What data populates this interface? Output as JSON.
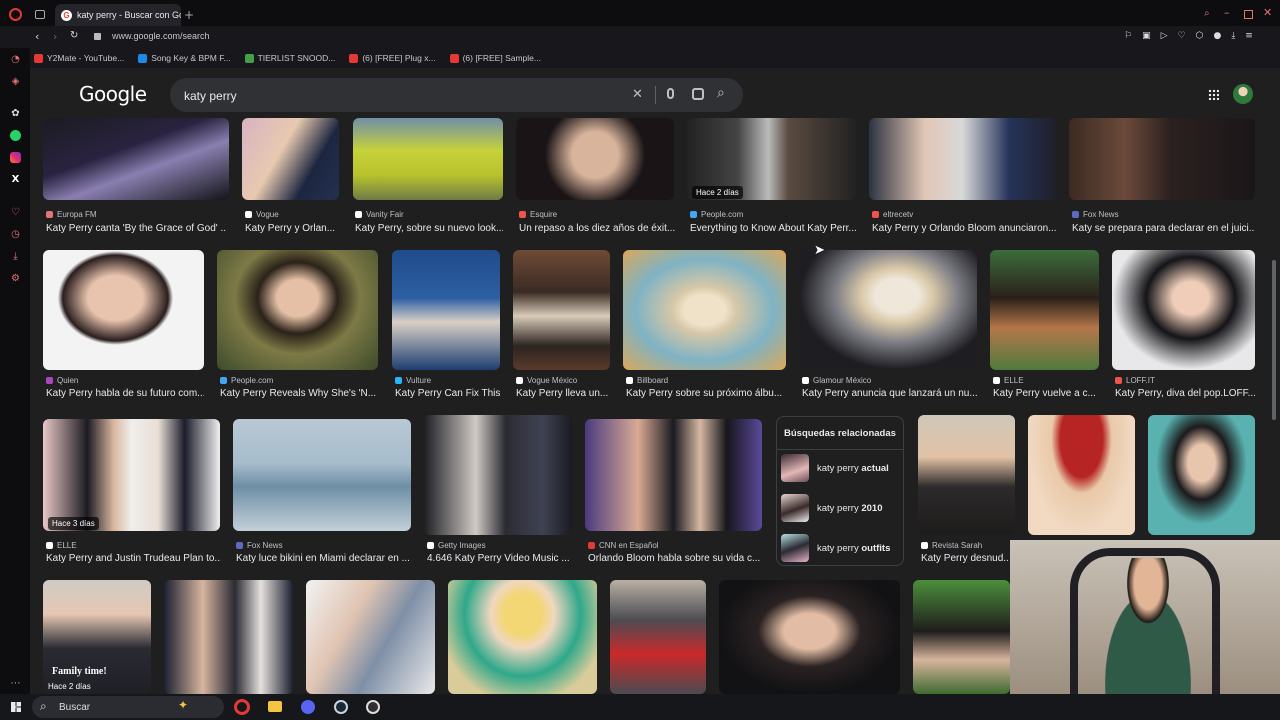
{
  "browser": {
    "tab_title": "katy perry - Buscar con Go",
    "url": "www.google.com/search",
    "bookmarks": [
      {
        "label": "Y2Mate - YouTube...",
        "color": "#e53935"
      },
      {
        "label": "Song Key & BPM F...",
        "color": "#1e88e5"
      },
      {
        "label": "TIERLIST SNOOD...",
        "color": "#43a047"
      },
      {
        "label": "(6) [FREE] Plug x...",
        "color": "#e53935"
      },
      {
        "label": "(6) [FREE] Sample...",
        "color": "#e53935"
      }
    ]
  },
  "google": {
    "logo": "Google",
    "query": "katy perry"
  },
  "row1": [
    {
      "source": "Europa FM",
      "caption": "Katy Perry canta 'By the Grace of God' ...",
      "badge": "",
      "src_color": "#e57373"
    },
    {
      "source": "Vogue",
      "caption": "Katy Perry y Orlan...",
      "badge": "",
      "src_color": "#ffffff"
    },
    {
      "source": "Vanity Fair",
      "caption": "Katy Perry, sobre su nuevo look...",
      "badge": "",
      "src_color": "#ffffff"
    },
    {
      "source": "Esquire",
      "caption": "Un repaso a los diez años de éxit...",
      "badge": "",
      "src_color": "#ef5350"
    },
    {
      "source": "People.com",
      "caption": "Everything to Know About Katy Perr...",
      "badge": "Hace 2 días",
      "src_color": "#42a5f5"
    },
    {
      "source": "eltrecetv",
      "caption": "Katy Perry y Orlando Bloom anunciaron...",
      "badge": "",
      "src_color": "#ef5350"
    },
    {
      "source": "Fox News",
      "caption": "Katy se prepara para declarar en el juici...",
      "badge": "",
      "src_color": "#5c6bc0"
    }
  ],
  "row2": [
    {
      "source": "Quien",
      "caption": "Katy Perry habla de su futuro com...",
      "src_color": "#ab47bc"
    },
    {
      "source": "People.com",
      "caption": "Katy Perry Reveals Why She's 'N...",
      "src_color": "#42a5f5"
    },
    {
      "source": "Vulture",
      "caption": "Katy Perry Can Fix This",
      "src_color": "#29b6f6"
    },
    {
      "source": "Vogue México",
      "caption": "Katy Perry lleva un...",
      "src_color": "#ffffff"
    },
    {
      "source": "Billboard",
      "caption": "Katy Perry sobre su próximo álbu...",
      "src_color": "#ffffff"
    },
    {
      "source": "Glamour México",
      "caption": "Katy Perry anuncia que lanzará un nu...",
      "src_color": "#ffffff"
    },
    {
      "source": "ELLE",
      "caption": "Katy Perry vuelve a c...",
      "src_color": "#ffffff"
    },
    {
      "source": "LOFF.IT",
      "caption": "Katy Perry, diva del pop.LOFF...",
      "src_color": "#ef5350"
    }
  ],
  "row3": [
    {
      "source": "ELLE",
      "caption": "Katy Perry and Justin Trudeau Plan to...",
      "badge": "Hace 3 días",
      "src_color": "#ffffff"
    },
    {
      "source": "Fox News",
      "caption": "Katy luce bikini en Miami declarar en ...",
      "badge": "",
      "src_color": "#5c6bc0"
    },
    {
      "source": "Getty Images",
      "caption": "4.646 Katy Perry Video Music ...",
      "badge": "",
      "src_color": "#ffffff"
    },
    {
      "source": "CNN en Español",
      "caption": "Orlando Bloom habla sobre su vida c...",
      "badge": "",
      "src_color": "#e53935"
    },
    {
      "source": "Revista Sarah",
      "caption": "Katy Perry desnud...",
      "badge": "",
      "src_color": "#ffffff"
    }
  ],
  "related": {
    "title": "Búsquedas relacionadas",
    "items": [
      {
        "prefix": "katy perry",
        "bold": "actual"
      },
      {
        "prefix": "katy perry",
        "bold": "2010"
      },
      {
        "prefix": "katy perry",
        "bold": "outfits"
      }
    ]
  },
  "row4": [
    {
      "badge": "Hace 2 días",
      "overlay": "Family time!"
    }
  ],
  "taskbar": {
    "search_placeholder": "Buscar"
  }
}
